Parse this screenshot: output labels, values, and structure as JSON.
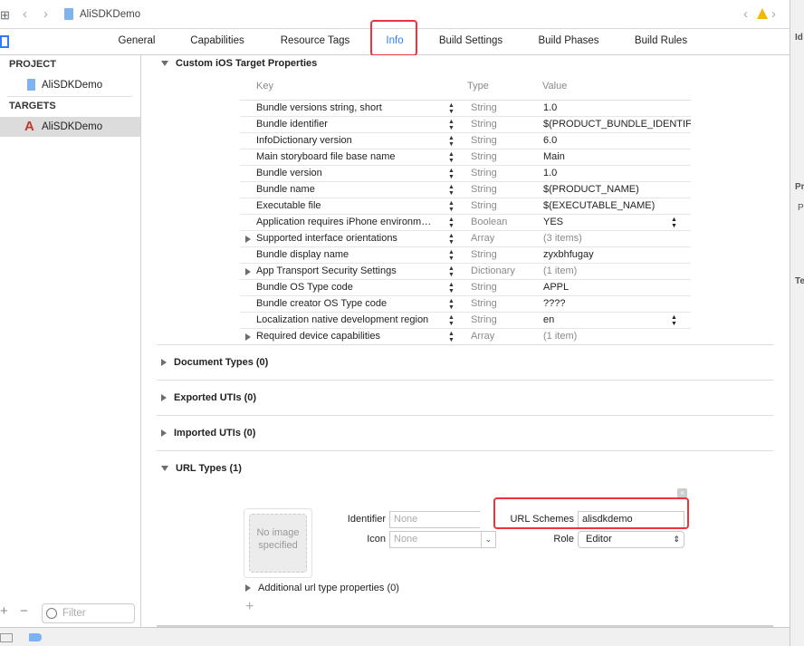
{
  "toolbar": {
    "project_name": "AliSDKDemo",
    "warning_icon": "warning-icon"
  },
  "tabs": [
    {
      "label": "General"
    },
    {
      "label": "Capabilities"
    },
    {
      "label": "Resource Tags"
    },
    {
      "label": "Info",
      "active": true
    },
    {
      "label": "Build Settings"
    },
    {
      "label": "Build Phases"
    },
    {
      "label": "Build Rules"
    }
  ],
  "sidebar": {
    "project_header": "PROJECT",
    "project_item": "AliSDKDemo",
    "targets_header": "TARGETS",
    "target_item": "AliSDKDemo",
    "filter_placeholder": "Filter"
  },
  "inspector": {
    "labels": [
      "Id",
      "Pr",
      "P",
      "Te"
    ]
  },
  "custom_props": {
    "title": "Custom iOS Target Properties",
    "headers": {
      "key": "Key",
      "type": "Type",
      "value": "Value"
    },
    "rows": [
      {
        "key": "Bundle versions string, short",
        "type": "String",
        "value": "1.0"
      },
      {
        "key": "Bundle identifier",
        "type": "String",
        "value": "$(PRODUCT_BUNDLE_IDENTIFIER)"
      },
      {
        "key": "InfoDictionary version",
        "type": "String",
        "value": "6.0"
      },
      {
        "key": "Main storyboard file base name",
        "type": "String",
        "value": "Main"
      },
      {
        "key": "Bundle version",
        "type": "String",
        "value": "1.0"
      },
      {
        "key": "Bundle name",
        "type": "String",
        "value": "$(PRODUCT_NAME)"
      },
      {
        "key": "Executable file",
        "type": "String",
        "value": "$(EXECUTABLE_NAME)"
      },
      {
        "key": "Application requires iPhone environm…",
        "type": "Boolean",
        "value": "YES"
      },
      {
        "key": "Supported interface orientations",
        "type": "Array",
        "value": "(3 items)"
      },
      {
        "key": "Bundle display name",
        "type": "String",
        "value": "zyxbhfugay"
      },
      {
        "key": "App Transport Security Settings",
        "type": "Dictionary",
        "value": "(1 item)"
      },
      {
        "key": "Bundle OS Type code",
        "type": "String",
        "value": "APPL"
      },
      {
        "key": "Bundle creator OS Type code",
        "type": "String",
        "value": "????"
      },
      {
        "key": "Localization native development region",
        "type": "String",
        "value": "en"
      },
      {
        "key": "Required device capabilities",
        "type": "Array",
        "value": "(1 item)"
      }
    ]
  },
  "sections": {
    "document_types": "Document Types (0)",
    "exported_utis": "Exported UTIs (0)",
    "imported_utis": "Imported UTIs (0)",
    "url_types": "URL Types (1)"
  },
  "url_type": {
    "image_placeholder": "No image specified",
    "identifier_label": "Identifier",
    "identifier_placeholder": "None",
    "icon_label": "Icon",
    "icon_placeholder": "None",
    "url_schemes_label": "URL Schemes",
    "url_schemes_value": "alisdkdemo",
    "role_label": "Role",
    "role_value": "Editor",
    "additional": "Additional url type properties (0)"
  },
  "colors": {
    "accent": "#2f7cf6",
    "highlight": "#f0323f"
  }
}
